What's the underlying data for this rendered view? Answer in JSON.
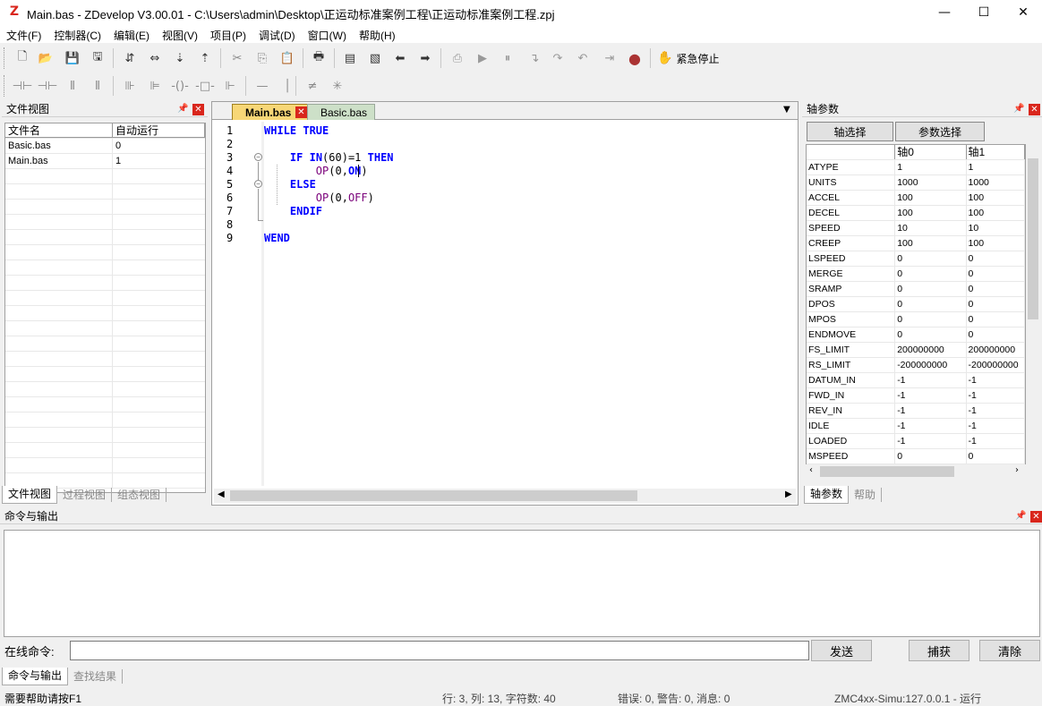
{
  "titlebar": {
    "title": "Main.bas - ZDevelop V3.00.01 - C:\\Users\\admin\\Desktop\\正运动标准案例工程\\正运动标准案例工程.zpj",
    "app_icon": "Z"
  },
  "menu": [
    "文件(F)",
    "控制器(C)",
    "编辑(E)",
    "视图(V)",
    "项目(P)",
    "调试(D)",
    "窗口(W)",
    "帮助(H)"
  ],
  "toolbar": {
    "estop_label": "紧急停止"
  },
  "fileview": {
    "title": "文件视图",
    "columns": [
      "文件名",
      "自动运行"
    ],
    "rows": [
      {
        "name": "Basic.bas",
        "auto": "0"
      },
      {
        "name": "Main.bas",
        "auto": "1"
      }
    ],
    "tabs": [
      "文件视图",
      "过程视图",
      "组态视图"
    ]
  },
  "editor": {
    "tabs": [
      "Main.bas",
      "Basic.bas"
    ],
    "line_numbers": [
      "1",
      "2",
      "3",
      "4",
      "5",
      "6",
      "7",
      "8",
      "9"
    ]
  },
  "axis": {
    "title": "轴参数",
    "buttons": [
      "轴选择",
      "参数选择"
    ],
    "columns": [
      "",
      "轴0",
      "轴1"
    ],
    "rows": [
      [
        "ATYPE",
        "1",
        "1"
      ],
      [
        "UNITS",
        "1000",
        "1000"
      ],
      [
        "ACCEL",
        "100",
        "100"
      ],
      [
        "DECEL",
        "100",
        "100"
      ],
      [
        "SPEED",
        "10",
        "10"
      ],
      [
        "CREEP",
        "100",
        "100"
      ],
      [
        "LSPEED",
        "0",
        "0"
      ],
      [
        "MERGE",
        "0",
        "0"
      ],
      [
        "SRAMP",
        "0",
        "0"
      ],
      [
        "DPOS",
        "0",
        "0"
      ],
      [
        "MPOS",
        "0",
        "0"
      ],
      [
        "ENDMOVE",
        "0",
        "0"
      ],
      [
        "FS_LIMIT",
        "200000000",
        "200000000"
      ],
      [
        "RS_LIMIT",
        "-200000000",
        "-200000000"
      ],
      [
        "DATUM_IN",
        "-1",
        "-1"
      ],
      [
        "FWD_IN",
        "-1",
        "-1"
      ],
      [
        "REV_IN",
        "-1",
        "-1"
      ],
      [
        "IDLE",
        "-1",
        "-1"
      ],
      [
        "LOADED",
        "-1",
        "-1"
      ],
      [
        "MSPEED",
        "0",
        "0"
      ]
    ],
    "tabs": [
      "轴参数",
      "帮助"
    ]
  },
  "command": {
    "title": "命令与输出",
    "label": "在线命令:",
    "input_value": "",
    "send": "发送",
    "capture": "捕获",
    "clear": "清除",
    "tabs": [
      "命令与输出",
      "查找结果"
    ]
  },
  "status": {
    "help": "需要帮助请按F1",
    "position": "行: 3, 列: 13, 字符数: 40",
    "errors": "错误: 0, 警告: 0, 消息: 0",
    "connection": "ZMC4xx-Simu:127.0.0.1 - 运行"
  }
}
